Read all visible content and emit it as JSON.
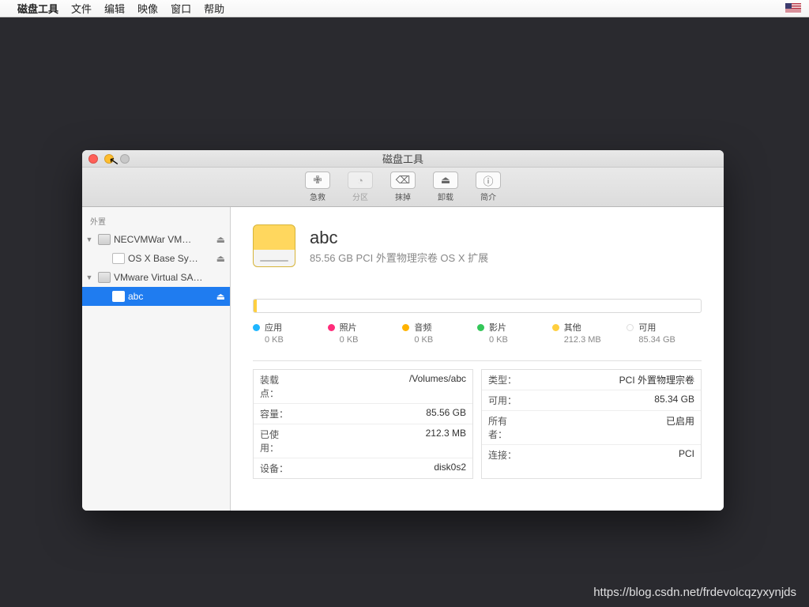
{
  "menubar": {
    "app": "磁盘工具",
    "items": [
      "文件",
      "编辑",
      "映像",
      "窗口",
      "帮助"
    ]
  },
  "window": {
    "title": "磁盘工具",
    "toolbar": [
      {
        "icon": "✙",
        "label": "急救",
        "disabled": false
      },
      {
        "icon": "◔",
        "label": "分区",
        "disabled": true
      },
      {
        "icon": "⌫",
        "label": "抹掉",
        "disabled": false
      },
      {
        "icon": "⏏",
        "label": "卸载",
        "disabled": false
      },
      {
        "icon": "ⓘ",
        "label": "简介",
        "disabled": false
      }
    ]
  },
  "sidebar": {
    "section": "外置",
    "items": [
      {
        "level": 0,
        "label": "NECVMWar VM…",
        "eject": true,
        "icon": "hdd",
        "disclosure": true
      },
      {
        "level": 1,
        "label": "OS X Base Sy…",
        "eject": true,
        "icon": "vol"
      },
      {
        "level": 0,
        "label": "VMware Virtual SA…",
        "eject": false,
        "icon": "hdd",
        "disclosure": true
      },
      {
        "level": 1,
        "label": "abc",
        "eject": true,
        "icon": "vol",
        "selected": true
      }
    ]
  },
  "volume": {
    "name": "abc",
    "subtitle": "85.56 GB PCI 外置物理宗卷 OS X 扩展"
  },
  "legend": [
    {
      "color": "#1fb6ff",
      "label": "应用",
      "value": "0 KB"
    },
    {
      "color": "#ff2d7a",
      "label": "照片",
      "value": "0 KB"
    },
    {
      "color": "#ffb300",
      "label": "音频",
      "value": "0 KB"
    },
    {
      "color": "#34c759",
      "label": "影片",
      "value": "0 KB"
    },
    {
      "color": "#ffcf3f",
      "label": "其他",
      "value": "212.3 MB"
    },
    {
      "color": "#ffffff",
      "label": "可用",
      "value": "85.34 GB"
    }
  ],
  "props_left": [
    {
      "k": "装载点：",
      "v": "/Volumes/abc"
    },
    {
      "k": "容量：",
      "v": "85.56 GB"
    },
    {
      "k": "已使用：",
      "v": "212.3 MB"
    },
    {
      "k": "设备：",
      "v": "disk0s2"
    }
  ],
  "props_right": [
    {
      "k": "类型：",
      "v": "PCI 外置物理宗卷"
    },
    {
      "k": "可用：",
      "v": "85.34 GB"
    },
    {
      "k": "所有者：",
      "v": "已启用"
    },
    {
      "k": "连接：",
      "v": "PCI"
    }
  ],
  "watermark": "https://blog.csdn.net/frdevolcqzyxynjds"
}
